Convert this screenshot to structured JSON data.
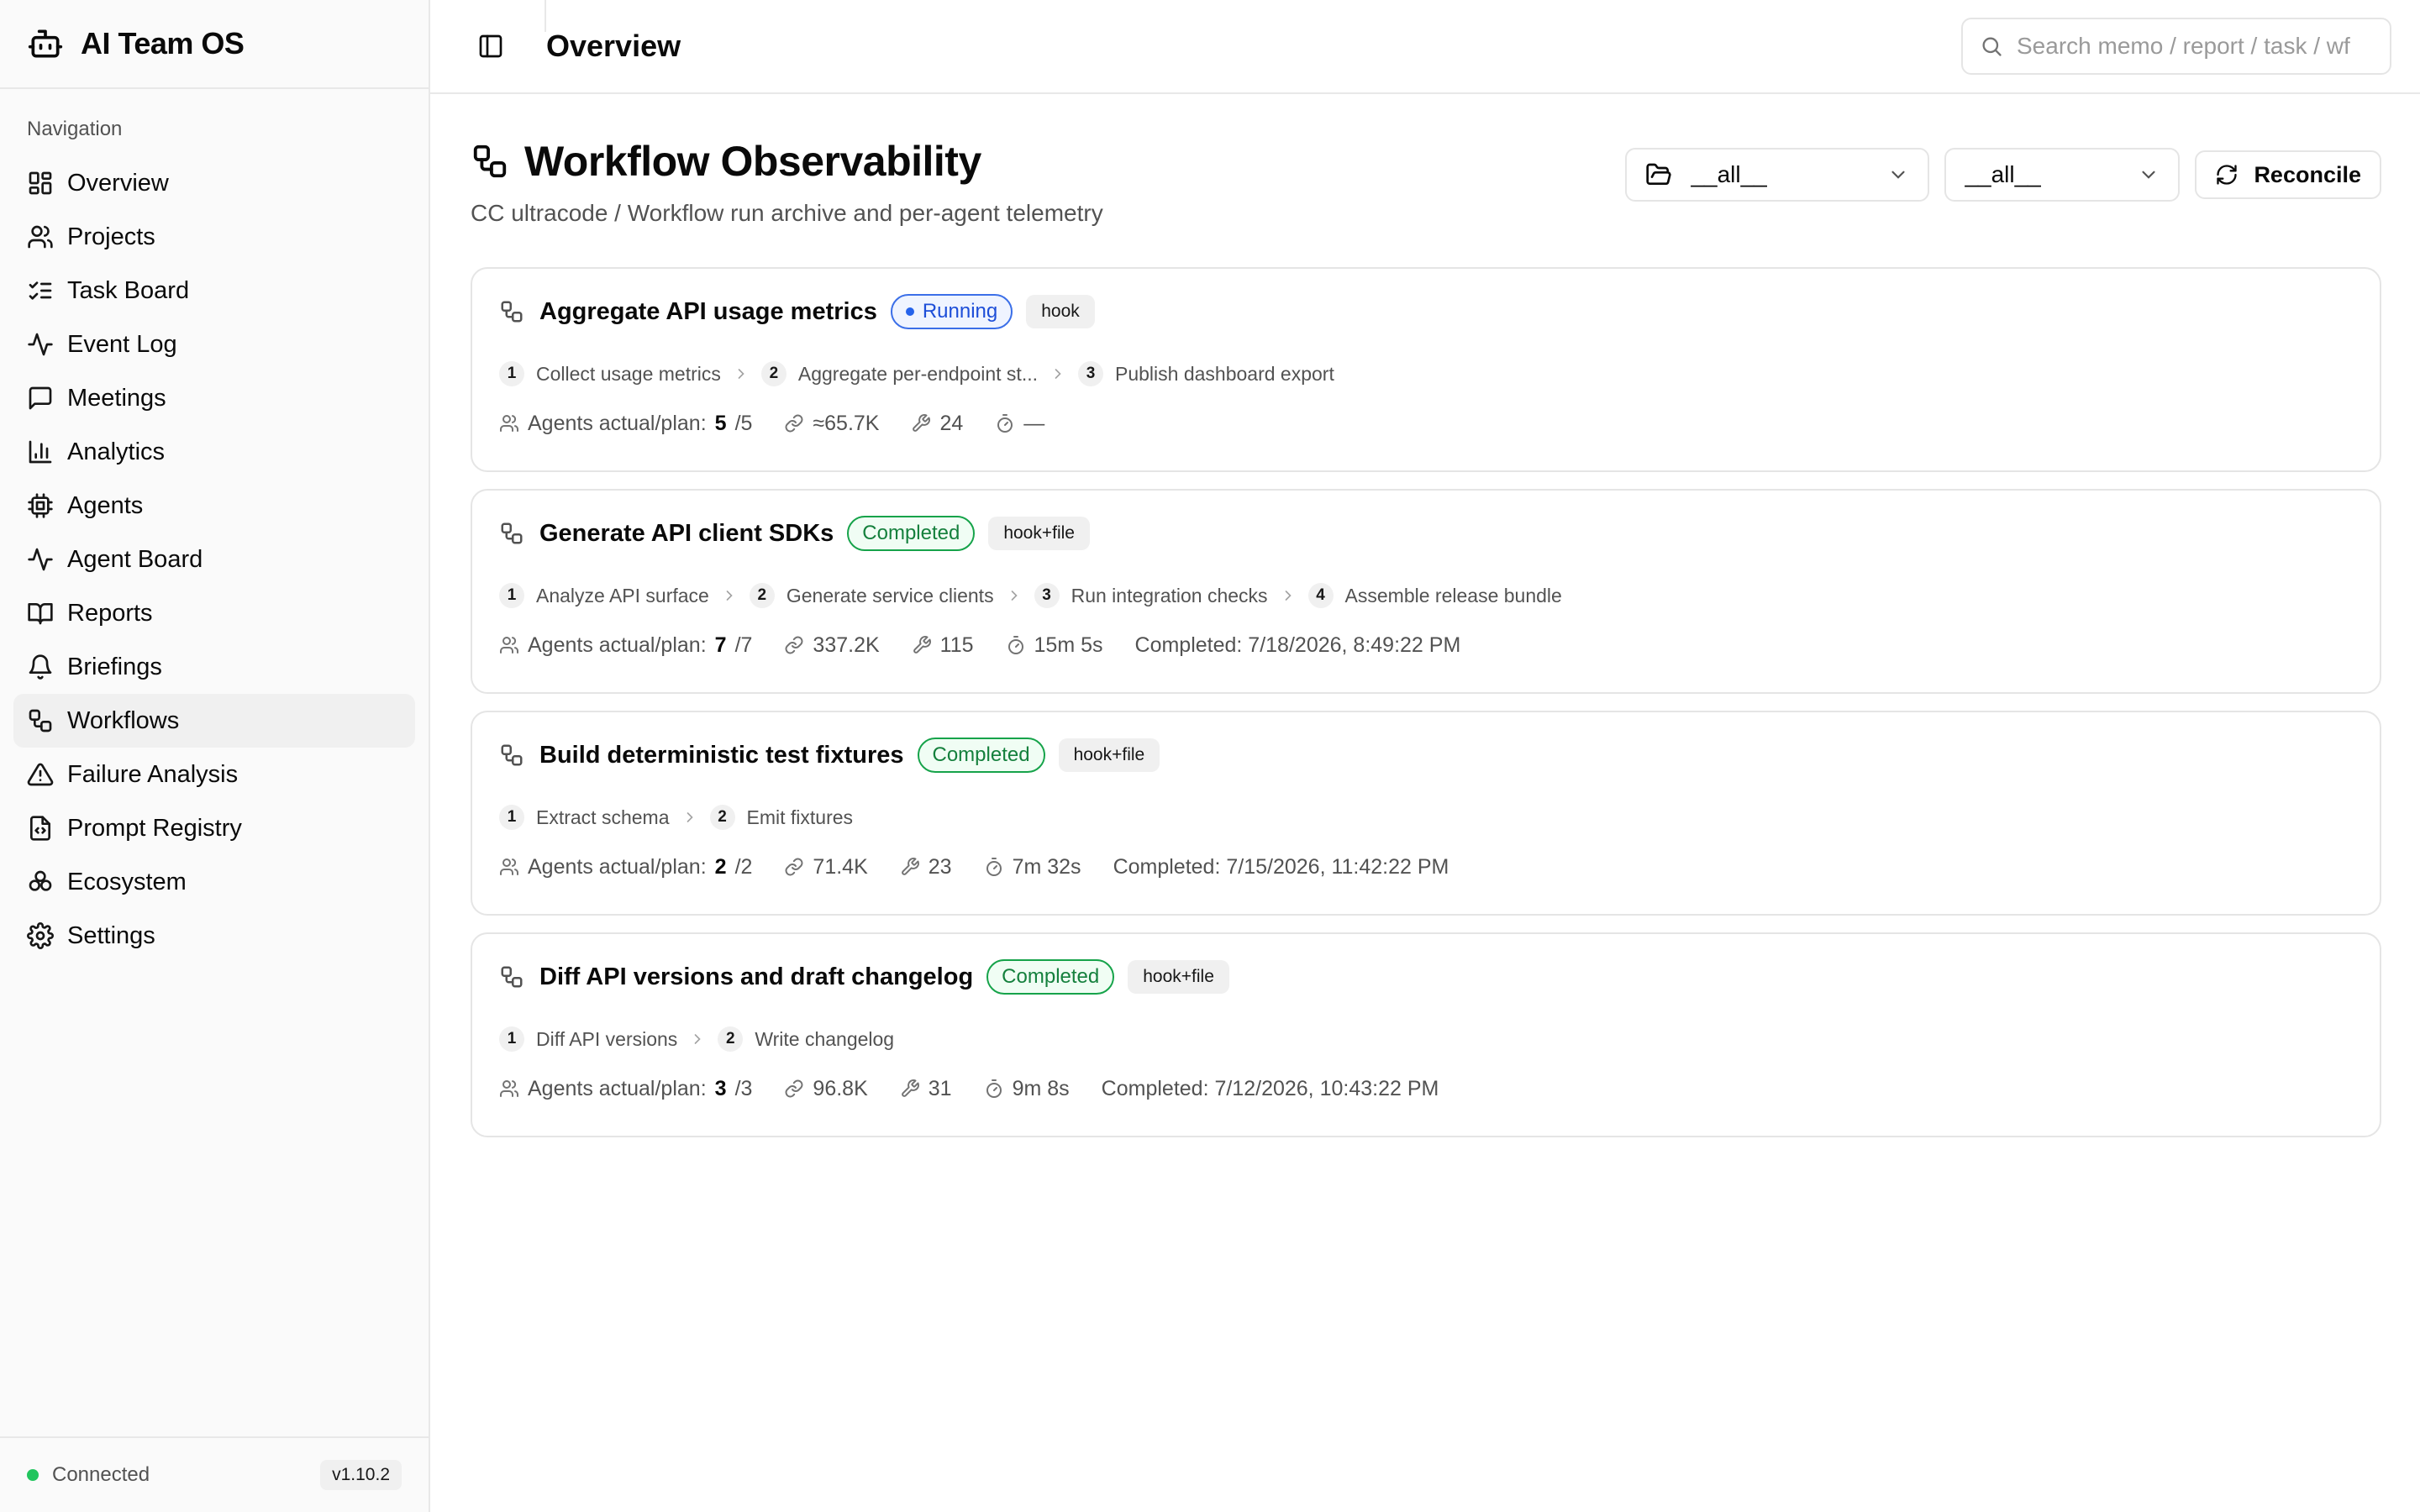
{
  "app": {
    "name": "AI Team OS",
    "version": "v1.10.2",
    "connection_status": "Connected"
  },
  "sidebar": {
    "heading": "Navigation",
    "items": [
      {
        "label": "Overview",
        "icon": "layout-dashboard-icon"
      },
      {
        "label": "Projects",
        "icon": "users-icon"
      },
      {
        "label": "Task Board",
        "icon": "list-checks-icon"
      },
      {
        "label": "Event Log",
        "icon": "activity-icon"
      },
      {
        "label": "Meetings",
        "icon": "message-square-icon"
      },
      {
        "label": "Analytics",
        "icon": "bar-chart-icon"
      },
      {
        "label": "Agents",
        "icon": "cpu-icon"
      },
      {
        "label": "Agent Board",
        "icon": "activity-icon"
      },
      {
        "label": "Reports",
        "icon": "book-open-icon"
      },
      {
        "label": "Briefings",
        "icon": "bell-icon"
      },
      {
        "label": "Workflows",
        "icon": "workflow-icon",
        "active": true
      },
      {
        "label": "Failure Analysis",
        "icon": "alert-triangle-icon"
      },
      {
        "label": "Prompt Registry",
        "icon": "file-code-icon"
      },
      {
        "label": "Ecosystem",
        "icon": "boxes-icon"
      },
      {
        "label": "Settings",
        "icon": "gear-icon"
      }
    ]
  },
  "topbar": {
    "title": "Overview",
    "search_placeholder": "Search memo / report / task / wf"
  },
  "page": {
    "title": "Workflow Observability",
    "subtitle": "CC ultracode / Workflow run archive and per-agent telemetry",
    "filter_project": "__all__",
    "filter_status": "__all__",
    "reconcile_label": "Reconcile"
  },
  "stats_label": "Agents actual/plan:",
  "workflows": [
    {
      "title": "Aggregate API usage metrics",
      "status": "Running",
      "status_kind": "running",
      "source": "hook",
      "steps": [
        {
          "n": "1",
          "label": "Collect usage metrics"
        },
        {
          "n": "2",
          "label": "Aggregate per-endpoint st..."
        },
        {
          "n": "3",
          "label": "Publish dashboard export"
        }
      ],
      "agents_actual": "5",
      "agents_plan": "/5",
      "tokens": "≈65.7K",
      "tool_calls": "24",
      "duration": "—",
      "completed": ""
    },
    {
      "title": "Generate API client SDKs",
      "status": "Completed",
      "status_kind": "completed",
      "source": "hook+file",
      "steps": [
        {
          "n": "1",
          "label": "Analyze API surface"
        },
        {
          "n": "2",
          "label": "Generate service clients"
        },
        {
          "n": "3",
          "label": "Run integration checks"
        },
        {
          "n": "4",
          "label": "Assemble release bundle"
        }
      ],
      "agents_actual": "7",
      "agents_plan": "/7",
      "tokens": "337.2K",
      "tool_calls": "115",
      "duration": "15m 5s",
      "completed": "Completed: 7/18/2026, 8:49:22 PM"
    },
    {
      "title": "Build deterministic test fixtures",
      "status": "Completed",
      "status_kind": "completed",
      "source": "hook+file",
      "steps": [
        {
          "n": "1",
          "label": "Extract schema"
        },
        {
          "n": "2",
          "label": "Emit fixtures"
        }
      ],
      "agents_actual": "2",
      "agents_plan": "/2",
      "tokens": "71.4K",
      "tool_calls": "23",
      "duration": "7m 32s",
      "completed": "Completed: 7/15/2026, 11:42:22 PM"
    },
    {
      "title": "Diff API versions and draft changelog",
      "status": "Completed",
      "status_kind": "completed",
      "source": "hook+file",
      "steps": [
        {
          "n": "1",
          "label": "Diff API versions"
        },
        {
          "n": "2",
          "label": "Write changelog"
        }
      ],
      "agents_actual": "3",
      "agents_plan": "/3",
      "tokens": "96.8K",
      "tool_calls": "31",
      "duration": "9m 8s",
      "completed": "Completed: 7/12/2026, 10:43:22 PM"
    }
  ],
  "colors": {
    "running": "#2563eb",
    "completed": "#16a34a",
    "connected": "#22c55e"
  }
}
